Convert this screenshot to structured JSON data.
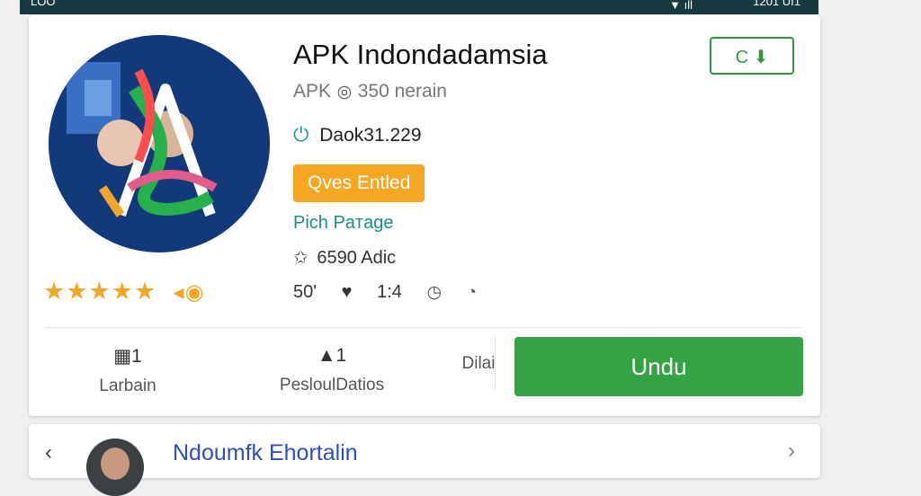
{
  "status_bar": {
    "left_text": "LOO",
    "middle_text": "",
    "time": "1201 UI1",
    "signal": "▼ ıll"
  },
  "app": {
    "title": "APK Indondadamsia",
    "meta": "APK",
    "meta_size": "350 nerain",
    "version": "Daok31.229",
    "status_badge": "Qves Entled",
    "package": "Pich Paтage",
    "stats": "6590 Adic",
    "rating_stars": "★★★★★",
    "misc": {
      "left": "50'",
      "middle": "1:4"
    },
    "top_action_label": "C"
  },
  "bottom_bar": {
    "items": [
      {
        "count": "1",
        "label": "Larbain"
      },
      {
        "count": "1",
        "label": "PesloulDatios"
      },
      {
        "count": "",
        "label": "Dilai"
      }
    ],
    "download_label": "Undu"
  },
  "next_card": {
    "title": "Ndoumfk Ehortalin"
  },
  "colors": {
    "accent_green": "#35a243",
    "badge_orange": "#f5a623",
    "teal": "#1a8f86",
    "link_blue": "#2a4fbf"
  },
  "icons": [
    "clock-icon",
    "power-icon",
    "star-outline-icon",
    "heart-icon",
    "download-icon",
    "calendar-icon",
    "thumb-icon",
    "chevron-left-icon",
    "chevron-right-icon",
    "badge-icon"
  ]
}
